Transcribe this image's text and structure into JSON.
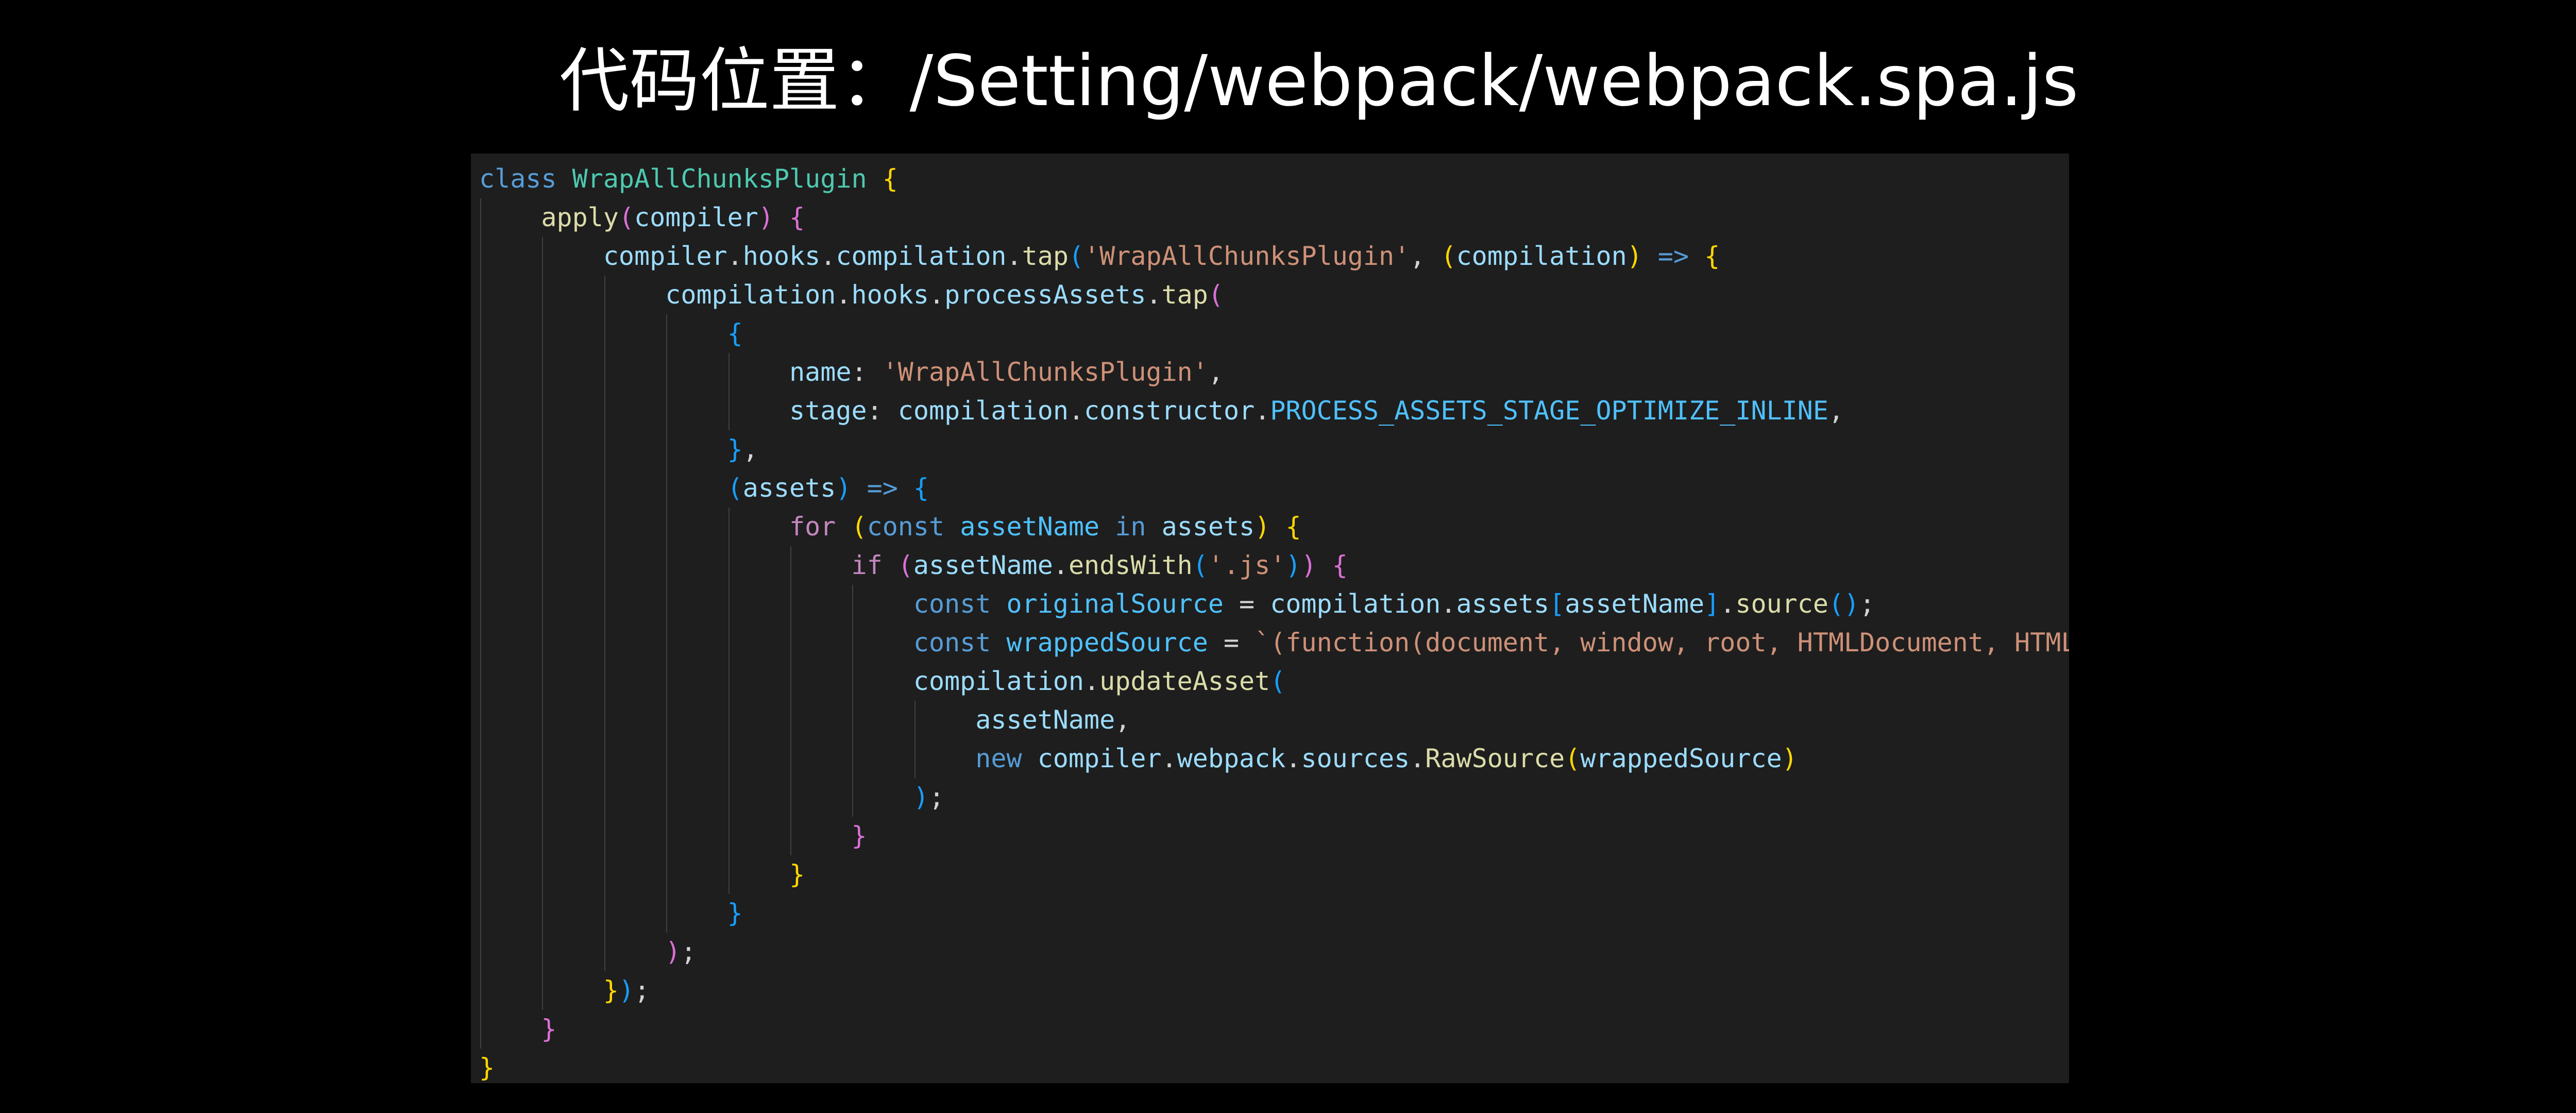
{
  "slide": {
    "title": "代码位置：/Setting/webpack/webpack.spa.js"
  },
  "colors": {
    "background": "#000000",
    "editor_background": "#1e1e1e",
    "keyword": "#569cd6",
    "control": "#c586c0",
    "class_name": "#4ec9b0",
    "function": "#dcdcaa",
    "variable": "#9cdcfe",
    "constant": "#4fc1ff",
    "string": "#ce9178",
    "bracket_level_1": "#ffd700",
    "bracket_level_2": "#da70d6",
    "bracket_level_3": "#179fff"
  },
  "code": {
    "lines": [
      [
        [
          "class",
          "kw"
        ],
        [
          " ",
          "pun"
        ],
        [
          "WrapAllChunksPlugin",
          "cls"
        ],
        [
          " ",
          "pun"
        ],
        [
          "{",
          "b1"
        ]
      ],
      [
        [
          "    ",
          "pun"
        ],
        [
          "apply",
          "fn"
        ],
        [
          "(",
          "b2"
        ],
        [
          "compiler",
          "var"
        ],
        [
          ")",
          "b2"
        ],
        [
          " ",
          "pun"
        ],
        [
          "{",
          "b2"
        ]
      ],
      [
        [
          "        ",
          "pun"
        ],
        [
          "compiler",
          "var"
        ],
        [
          ".",
          "pun"
        ],
        [
          "hooks",
          "var"
        ],
        [
          ".",
          "pun"
        ],
        [
          "compilation",
          "var"
        ],
        [
          ".",
          "pun"
        ],
        [
          "tap",
          "fn"
        ],
        [
          "(",
          "b3"
        ],
        [
          "'WrapAllChunksPlugin'",
          "str"
        ],
        [
          ", ",
          "pun"
        ],
        [
          "(",
          "b1"
        ],
        [
          "compilation",
          "var"
        ],
        [
          ")",
          "b1"
        ],
        [
          " ",
          "pun"
        ],
        [
          "=>",
          "kw"
        ],
        [
          " ",
          "pun"
        ],
        [
          "{",
          "b1"
        ]
      ],
      [
        [
          "            ",
          "pun"
        ],
        [
          "compilation",
          "var"
        ],
        [
          ".",
          "pun"
        ],
        [
          "hooks",
          "var"
        ],
        [
          ".",
          "pun"
        ],
        [
          "processAssets",
          "var"
        ],
        [
          ".",
          "pun"
        ],
        [
          "tap",
          "fn"
        ],
        [
          "(",
          "b2"
        ]
      ],
      [
        [
          "                ",
          "pun"
        ],
        [
          "{",
          "b3"
        ]
      ],
      [
        [
          "                    ",
          "pun"
        ],
        [
          "name",
          "var"
        ],
        [
          ": ",
          "pun"
        ],
        [
          "'WrapAllChunksPlugin'",
          "str"
        ],
        [
          ",",
          "pun"
        ]
      ],
      [
        [
          "                    ",
          "pun"
        ],
        [
          "stage",
          "var"
        ],
        [
          ": ",
          "pun"
        ],
        [
          "compilation",
          "var"
        ],
        [
          ".",
          "pun"
        ],
        [
          "constructor",
          "var"
        ],
        [
          ".",
          "pun"
        ],
        [
          "PROCESS_ASSETS_STAGE_OPTIMIZE_INLINE",
          "con"
        ],
        [
          ",",
          "pun"
        ]
      ],
      [
        [
          "                ",
          "pun"
        ],
        [
          "}",
          "b3"
        ],
        [
          ",",
          "pun"
        ]
      ],
      [
        [
          "                ",
          "pun"
        ],
        [
          "(",
          "b3"
        ],
        [
          "assets",
          "var"
        ],
        [
          ")",
          "b3"
        ],
        [
          " ",
          "pun"
        ],
        [
          "=>",
          "kw"
        ],
        [
          " ",
          "pun"
        ],
        [
          "{",
          "b3"
        ]
      ],
      [
        [
          "                    ",
          "pun"
        ],
        [
          "for",
          "ctl"
        ],
        [
          " ",
          "pun"
        ],
        [
          "(",
          "b1"
        ],
        [
          "const",
          "kw"
        ],
        [
          " ",
          "pun"
        ],
        [
          "assetName",
          "con"
        ],
        [
          " ",
          "pun"
        ],
        [
          "in",
          "kw"
        ],
        [
          " ",
          "pun"
        ],
        [
          "assets",
          "var"
        ],
        [
          ")",
          "b1"
        ],
        [
          " ",
          "pun"
        ],
        [
          "{",
          "b1"
        ]
      ],
      [
        [
          "                        ",
          "pun"
        ],
        [
          "if",
          "ctl"
        ],
        [
          " ",
          "pun"
        ],
        [
          "(",
          "b2"
        ],
        [
          "assetName",
          "var"
        ],
        [
          ".",
          "pun"
        ],
        [
          "endsWith",
          "fn"
        ],
        [
          "(",
          "b3"
        ],
        [
          "'.js'",
          "str"
        ],
        [
          ")",
          "b3"
        ],
        [
          ")",
          "b2"
        ],
        [
          " ",
          "pun"
        ],
        [
          "{",
          "b2"
        ]
      ],
      [
        [
          "                            ",
          "pun"
        ],
        [
          "const",
          "kw"
        ],
        [
          " ",
          "pun"
        ],
        [
          "originalSource",
          "con"
        ],
        [
          " = ",
          "pun"
        ],
        [
          "compilation",
          "var"
        ],
        [
          ".",
          "pun"
        ],
        [
          "assets",
          "var"
        ],
        [
          "[",
          "b3"
        ],
        [
          "assetName",
          "var"
        ],
        [
          "]",
          "b3"
        ],
        [
          ".",
          "pun"
        ],
        [
          "source",
          "fn"
        ],
        [
          "()",
          "b3"
        ],
        [
          ";",
          "pun"
        ]
      ],
      [
        [
          "                            ",
          "pun"
        ],
        [
          "const",
          "kw"
        ],
        [
          " ",
          "pun"
        ],
        [
          "wrappedSource",
          "con"
        ],
        [
          " = ",
          "pun"
        ],
        [
          "`(function(document, window, root, HTMLDocument, HTML",
          "str"
        ]
      ],
      [
        [
          "                            ",
          "pun"
        ],
        [
          "compilation",
          "var"
        ],
        [
          ".",
          "pun"
        ],
        [
          "updateAsset",
          "fn"
        ],
        [
          "(",
          "b3"
        ]
      ],
      [
        [
          "                                ",
          "pun"
        ],
        [
          "assetName",
          "var"
        ],
        [
          ",",
          "pun"
        ]
      ],
      [
        [
          "                                ",
          "pun"
        ],
        [
          "new",
          "kw"
        ],
        [
          " ",
          "pun"
        ],
        [
          "compiler",
          "var"
        ],
        [
          ".",
          "pun"
        ],
        [
          "webpack",
          "var"
        ],
        [
          ".",
          "pun"
        ],
        [
          "sources",
          "var"
        ],
        [
          ".",
          "pun"
        ],
        [
          "RawSource",
          "fn"
        ],
        [
          "(",
          "b1"
        ],
        [
          "wrappedSource",
          "var"
        ],
        [
          ")",
          "b1"
        ]
      ],
      [
        [
          "                            ",
          "pun"
        ],
        [
          ")",
          "b3"
        ],
        [
          ";",
          "pun"
        ]
      ],
      [
        [
          "                        ",
          "pun"
        ],
        [
          "}",
          "b2"
        ]
      ],
      [
        [
          "                    ",
          "pun"
        ],
        [
          "}",
          "b1"
        ]
      ],
      [
        [
          "                ",
          "pun"
        ],
        [
          "}",
          "b3"
        ]
      ],
      [
        [
          "            ",
          "pun"
        ],
        [
          ")",
          "b2"
        ],
        [
          ";",
          "pun"
        ]
      ],
      [
        [
          "        ",
          "pun"
        ],
        [
          "}",
          "b1"
        ],
        [
          ")",
          "b3"
        ],
        [
          ";",
          "pun"
        ]
      ],
      [
        [
          "    ",
          "pun"
        ],
        [
          "}",
          "b2"
        ]
      ],
      [
        [
          "}",
          "b1"
        ]
      ]
    ]
  }
}
